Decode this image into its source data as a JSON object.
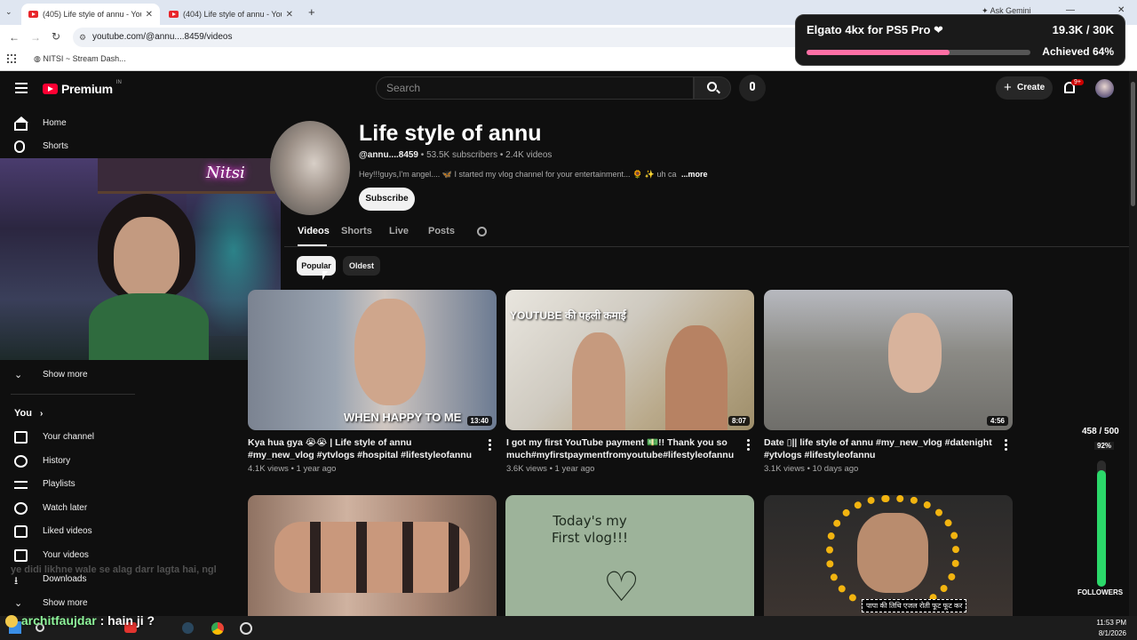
{
  "browser": {
    "tabs": [
      {
        "title": "(405) Life style of annu - YouTube"
      },
      {
        "title": "(404) Life style of annu - YouTube"
      }
    ],
    "url": "youtube.com/@annu....8459/videos",
    "ask_gemini": "Ask Gemini",
    "bookmark": "NITSI ~ Stream Dash..."
  },
  "yt": {
    "logo": "Premium",
    "region": "IN",
    "search_placeholder": "Search",
    "create_label": "Create",
    "notif_count": "9+"
  },
  "sidebar": {
    "top": [
      {
        "label": "Home",
        "icon": "home-icon"
      },
      {
        "label": "Shorts",
        "icon": "shorts-icon"
      }
    ],
    "show_more_top": "Show more",
    "you_label": "You",
    "you_items": [
      {
        "label": "Your channel",
        "icon": "channel-icon"
      },
      {
        "label": "History",
        "icon": "history-icon"
      },
      {
        "label": "Playlists",
        "icon": "playlists-icon"
      },
      {
        "label": "Watch later",
        "icon": "watch-later-icon"
      },
      {
        "label": "Liked videos",
        "icon": "like-icon"
      },
      {
        "label": "Your videos",
        "icon": "your-videos-icon"
      },
      {
        "label": "Downloads",
        "icon": "download-icon"
      }
    ],
    "show_more_bottom": "Show more"
  },
  "channel": {
    "name": "Life style of annu",
    "handle": "@annu....8459",
    "subscribers": "53.5K subscribers",
    "videos_count": "2.4K videos",
    "description": "Hey!!!guys,I'm angel.... 🦋 I started my vlog channel for your entertainment... 🌻 ✨ uh ca",
    "more": "...more",
    "subscribe": "Subscribe",
    "tabs": [
      "Videos",
      "Shorts",
      "Live",
      "Posts"
    ],
    "chips": [
      "Popular",
      "Oldest"
    ]
  },
  "videos": [
    {
      "title": "Kya hua gya 😭😭 | Life style of annu #my_new_vlog #ytvlogs #hospital  #lifestyleofannu",
      "views": "4.1K views",
      "age": "1 year ago",
      "duration": "13:40",
      "overlay": "WHEN HAPPY TO ME"
    },
    {
      "title": "I got my first YouTube payment 💵!! Thank you so much#myfirstpaymentfromyoutube#lifestyleofannu",
      "views": "3.6K views",
      "age": "1 year ago",
      "duration": "8:07",
      "overlay": "YOUTUBE की पहली कमाई"
    },
    {
      "title": "Date ▯|| life style of annu #my_new_vlog #datenight #ytvlogs #lifestyleofannu",
      "views": "3.1K views",
      "age": "10 days ago",
      "duration": "4:56",
      "overlay": ""
    },
    {
      "title": "",
      "views": "",
      "age": "",
      "duration": "",
      "overlay": ""
    },
    {
      "title": "",
      "views": "",
      "age": "",
      "duration": "",
      "overlay": "Today's my First vlog!!!"
    },
    {
      "title": "",
      "views": "",
      "age": "",
      "duration": "",
      "overlay": "पापा की तिथि एजल रोती फूट फूट कर"
    }
  ],
  "overlays": {
    "goal_title": "Elgato 4kx for PS5 Pro ❤",
    "goal_count": "19.3K / 30K",
    "goal_status": "Achieved 64%",
    "goal_fraction": 0.64,
    "followers_count": "458 / 500",
    "followers_pct": "92%",
    "followers_fraction": 0.92,
    "followers_label": "FOLLOWERS",
    "webcam_tag": "Nitsi",
    "chat_ghost": "ye didi likhne wale se alag darr lagta hai, ngl",
    "chat_user": "architfaujdar",
    "chat_text": "hain ji ?"
  },
  "taskbar": {
    "time": "11:53 PM",
    "date": "8/1/2026"
  }
}
